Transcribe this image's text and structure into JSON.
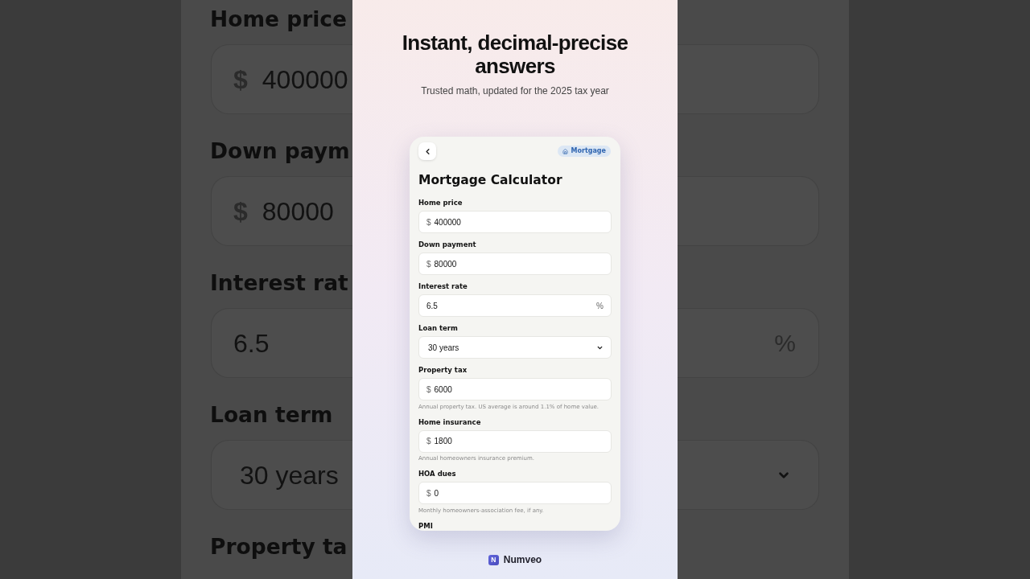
{
  "backdrop": {
    "fields": [
      {
        "kind": "input",
        "label": "Home price",
        "prefix": "$",
        "value": "400000"
      },
      {
        "kind": "input",
        "label": "Down paym",
        "prefix": "$",
        "value": "80000"
      },
      {
        "kind": "input",
        "label": "Interest rat",
        "value": "6.5",
        "suffix": "%"
      },
      {
        "kind": "select",
        "label": "Loan term",
        "value": "30 years"
      },
      {
        "kind": "label",
        "label": "Property ta"
      }
    ]
  },
  "headline": "Instant, decimal-precise answers",
  "subtitle": "Trusted math, updated for the 2025 tax year",
  "card": {
    "badge": "Mortgage",
    "title": "Mortgage Calculator",
    "fields": [
      {
        "kind": "input",
        "label": "Home price",
        "prefix": "$",
        "value": "400000"
      },
      {
        "kind": "input",
        "label": "Down payment",
        "prefix": "$",
        "value": "80000"
      },
      {
        "kind": "input",
        "label": "Interest rate",
        "value": "6.5",
        "suffix": "%"
      },
      {
        "kind": "select",
        "label": "Loan term",
        "value": "30 years"
      },
      {
        "kind": "input",
        "label": "Property tax",
        "prefix": "$",
        "value": "6000",
        "hint": "Annual property tax. US average is around 1.1% of home value."
      },
      {
        "kind": "input",
        "label": "Home insurance",
        "prefix": "$",
        "value": "1800",
        "hint": "Annual homeowners insurance premium."
      },
      {
        "kind": "input",
        "label": "HOA dues",
        "prefix": "$",
        "value": "0",
        "hint": "Monthly homeowners-association fee, if any."
      },
      {
        "kind": "label",
        "label": "PMI"
      }
    ]
  },
  "footer": {
    "logo_letter": "N",
    "brand": "Numveo"
  }
}
